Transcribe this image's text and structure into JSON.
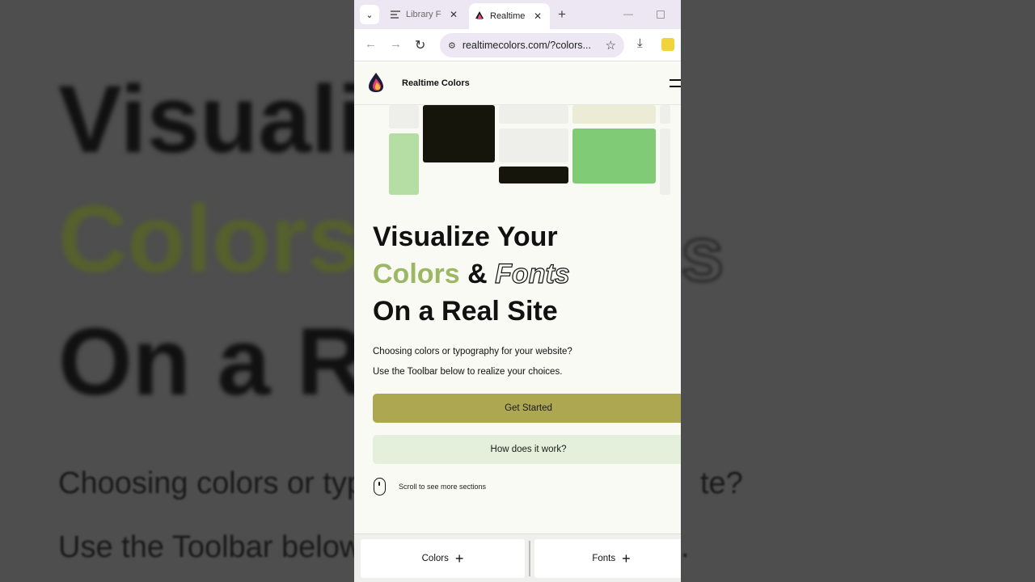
{
  "browser": {
    "tabs": [
      {
        "title": "Library Fonts",
        "icon": "library-icon"
      },
      {
        "title": "Realtime Colors",
        "icon": "realtime-colors-logo-icon"
      }
    ],
    "url": "realtimecolors.com/?colors..."
  },
  "site": {
    "brand": "Realtime Colors",
    "hero": {
      "line1": "Visualize Your",
      "colors_word": "Colors",
      "amp": "&",
      "fonts_word": "Fonts",
      "line3": "On a Real Site"
    },
    "paragraph1": "Choosing colors or typography for your website?",
    "paragraph2": "Use the Toolbar below to realize your choices.",
    "primary_button": "Get Started",
    "secondary_button": "How does it work?",
    "scroll_hint": "Scroll to see more sections",
    "colors": {
      "background": "#f9faf4",
      "text": "#111111",
      "primary": "#aea751",
      "secondary": "#e4f0dc",
      "accent": "#9cb865"
    }
  },
  "toolbar": {
    "colors_label": "Colors",
    "fonts_label": "Fonts"
  },
  "backdrop": {
    "line1": "Visuali",
    "line2": "Colors",
    "line3": "On a Re",
    "right_fragment": "s",
    "para1": "Choosing colors or typ",
    "para1_end": "te?",
    "para2": "Use the Toolbar below",
    "para2_end": "."
  }
}
